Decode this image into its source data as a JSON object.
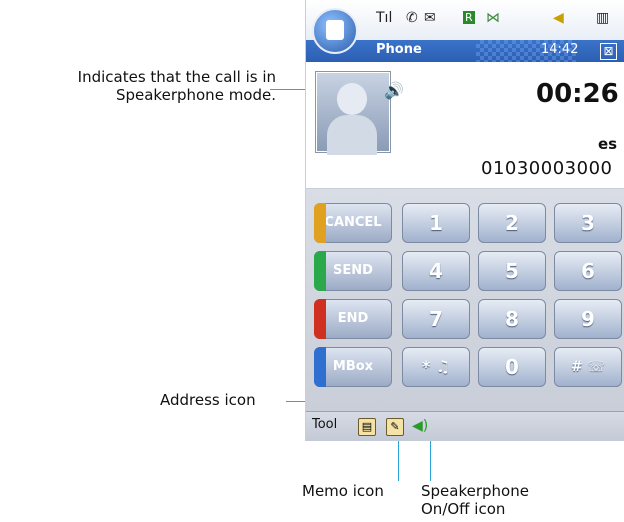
{
  "annotations": {
    "speaker_mode": "Indicates that the call is in Speakerphone mode.",
    "address_icon": "Address icon",
    "memo_icon": "Memo icon",
    "speakerphone_toggle": "Speakerphone On/Off icon"
  },
  "phone": {
    "title": "Phone",
    "clock": "14:42",
    "close_glyph": "⊠",
    "status_icons": [
      {
        "name": "signal-icon",
        "glyph": "Tıl"
      },
      {
        "name": "call-icon",
        "glyph": "✆"
      },
      {
        "name": "message-icon",
        "glyph": "✉"
      },
      {
        "name": "roaming-icon",
        "glyph": "R"
      },
      {
        "name": "bluetooth-icon",
        "glyph": "⋈"
      },
      {
        "name": "volume-icon",
        "glyph": "◀"
      },
      {
        "name": "battery-icon",
        "glyph": "▥"
      }
    ],
    "call": {
      "timer": "00:26",
      "name": "es",
      "number": "01030003000",
      "speaker_glyph": "🔊"
    },
    "function_keys": [
      {
        "label": "CANCEL",
        "color": "#e0a020"
      },
      {
        "label": "SEND",
        "color": "#2aa84a"
      },
      {
        "label": "END",
        "color": "#d03020"
      },
      {
        "label": "MBox",
        "color": "#2f6fd0"
      }
    ],
    "keys": [
      [
        "1",
        "2",
        "3"
      ],
      [
        "4",
        "5",
        "6"
      ],
      [
        "7",
        "8",
        "9"
      ],
      [
        "* ♫",
        "0",
        "# ☏"
      ]
    ],
    "toolbar": {
      "label": "Tool"
    }
  }
}
